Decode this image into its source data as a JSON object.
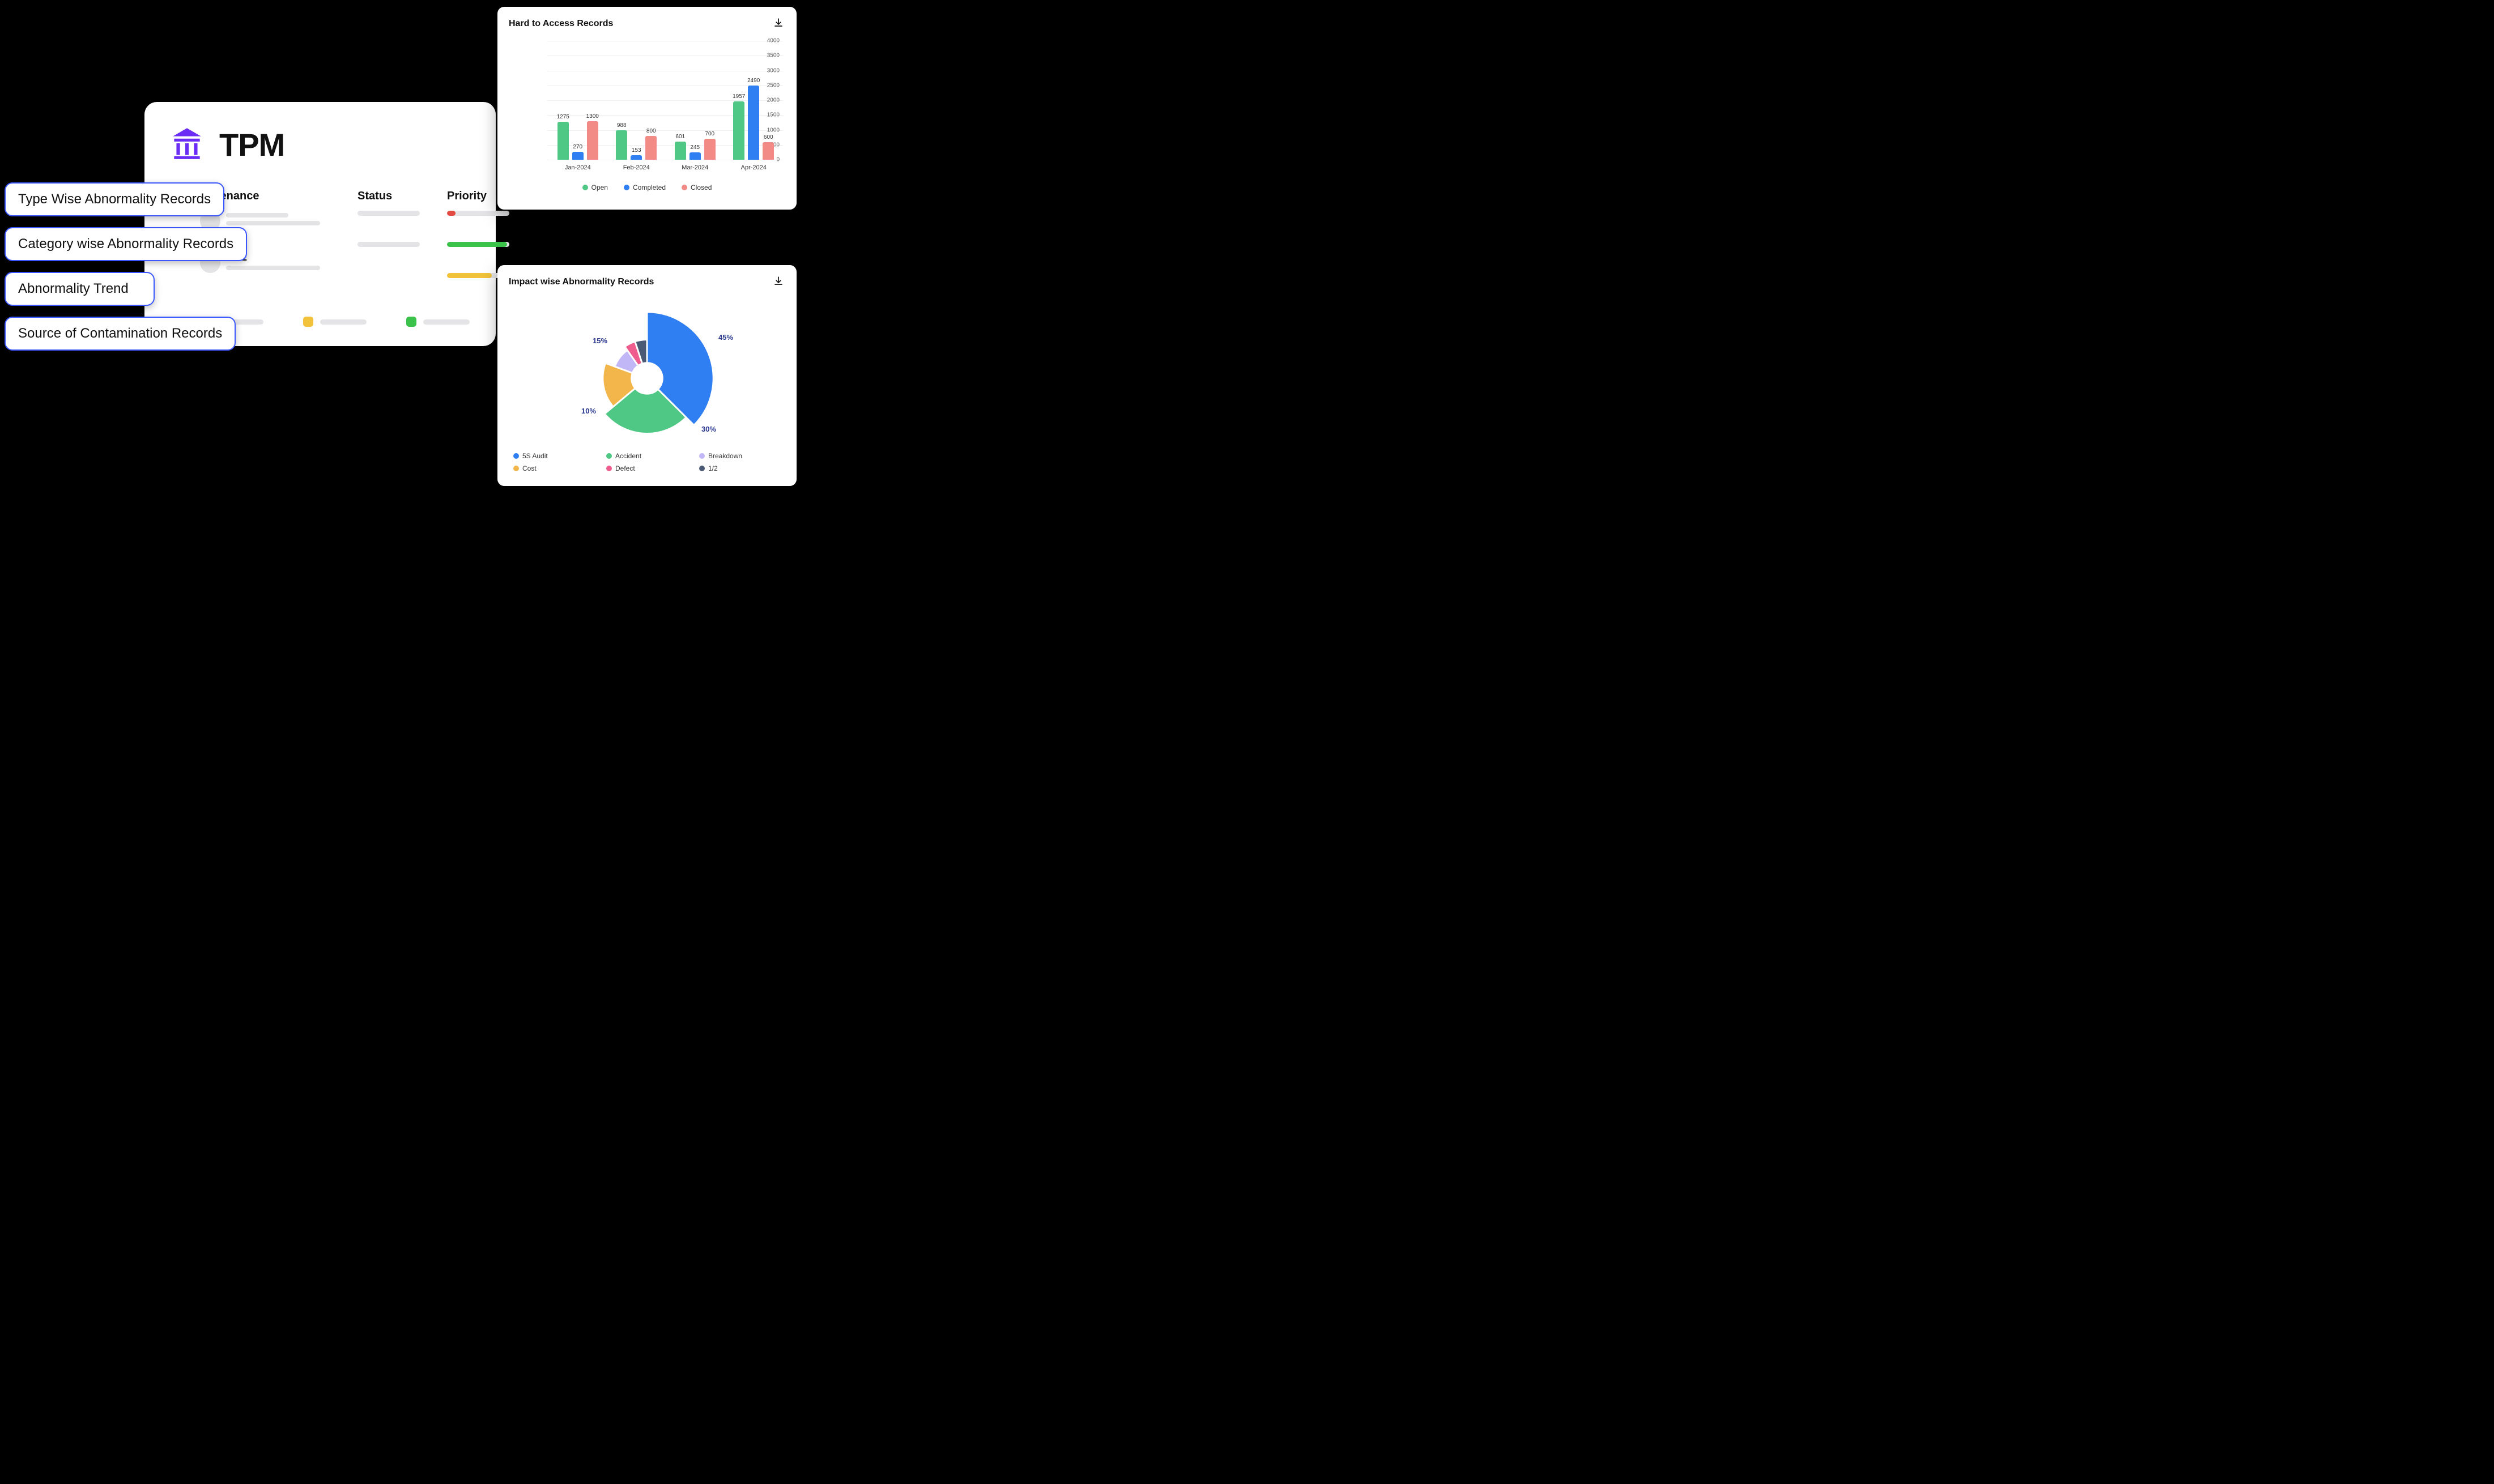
{
  "tpm": {
    "title": "TPM",
    "col_maint": "aintenance",
    "col_status": "Status",
    "col_priority": "Priority",
    "row2_label": "SHE",
    "chip_colors": [
      "#e24b42",
      "#f2c23a",
      "#3ac24a"
    ]
  },
  "pills": [
    "Type Wise Abnormality Records",
    "Category wise Abnormality Records",
    "Abnormality Trend",
    "Source of Contamination Records"
  ],
  "bar_card_title": "Hard to Access Records",
  "pie_card_title": "Impact wise Abnormality Records",
  "chart_data": [
    {
      "type": "bar",
      "title": "Hard to Access Records",
      "categories": [
        "Jan-2024",
        "Feb-2024",
        "Mar-2024",
        "Apr-2024"
      ],
      "series": [
        {
          "name": "Open",
          "color": "#4fc785",
          "values": [
            1275,
            988,
            601,
            1957
          ]
        },
        {
          "name": "Completed",
          "color": "#2f7ef2",
          "values": [
            270,
            153,
            245,
            2490
          ]
        },
        {
          "name": "Closed",
          "color": "#f28a85",
          "values": [
            1300,
            800,
            700,
            600
          ]
        }
      ],
      "ylim": [
        0,
        4000
      ],
      "yticks": [
        0,
        500,
        1000,
        1500,
        2000,
        2500,
        3000,
        3500,
        4000
      ]
    },
    {
      "type": "pie",
      "title": "Impact wise Abnormality Records",
      "labels": [
        "5S Audit",
        "Accident",
        "Breakdown",
        "Cost",
        "Defect",
        "1/2"
      ],
      "colors": [
        "#2f7ef2",
        "#4fc785",
        "#c1b7f6",
        "#f2b64a",
        "#ef5d8f",
        "#4a5a74"
      ],
      "values_pct": [
        45,
        30,
        null,
        10,
        15,
        null
      ],
      "visible_value_labels": [
        "45%",
        "30%",
        "10%",
        "15%"
      ]
    }
  ]
}
